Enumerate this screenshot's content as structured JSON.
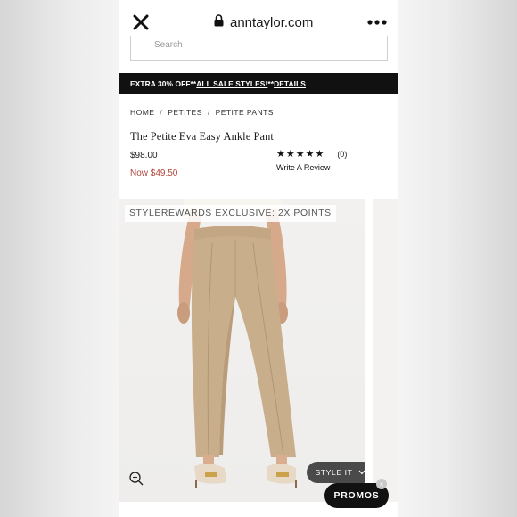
{
  "browser": {
    "url": "anntaylor.com",
    "close_icon": "close-icon",
    "lock_icon": "lock-icon",
    "more_icon": "more-icon"
  },
  "search": {
    "placeholder": "Search"
  },
  "promo_banner": {
    "part1": "EXTRA 30% OFF** ",
    "link": "ALL SALE STYLES!",
    "part2": " **",
    "details": "DETAILS"
  },
  "breadcrumb": [
    {
      "label": "HOME"
    },
    {
      "label": "PETITES"
    },
    {
      "label": "PETITE PANTS"
    }
  ],
  "breadcrumb_sep": "/",
  "product": {
    "title": "The Petite Eva Easy Ankle Pant",
    "original_price": "$98.00",
    "sale_price": "Now $49.50",
    "stars": "★★★★★",
    "review_count": "(0)",
    "write_review": "Write A Review"
  },
  "image": {
    "badge": "STYLEREWARDS EXCLUSIVE: 2X POINTS",
    "zoom_icon": "zoom-in-icon"
  },
  "buttons": {
    "style_it": "STYLE IT",
    "promos": "PROMOS",
    "promos_close": "×"
  },
  "colors": {
    "banner_bg": "#111111",
    "sale_price": "#b0463a",
    "pant_tan": "#c9ae8c"
  }
}
